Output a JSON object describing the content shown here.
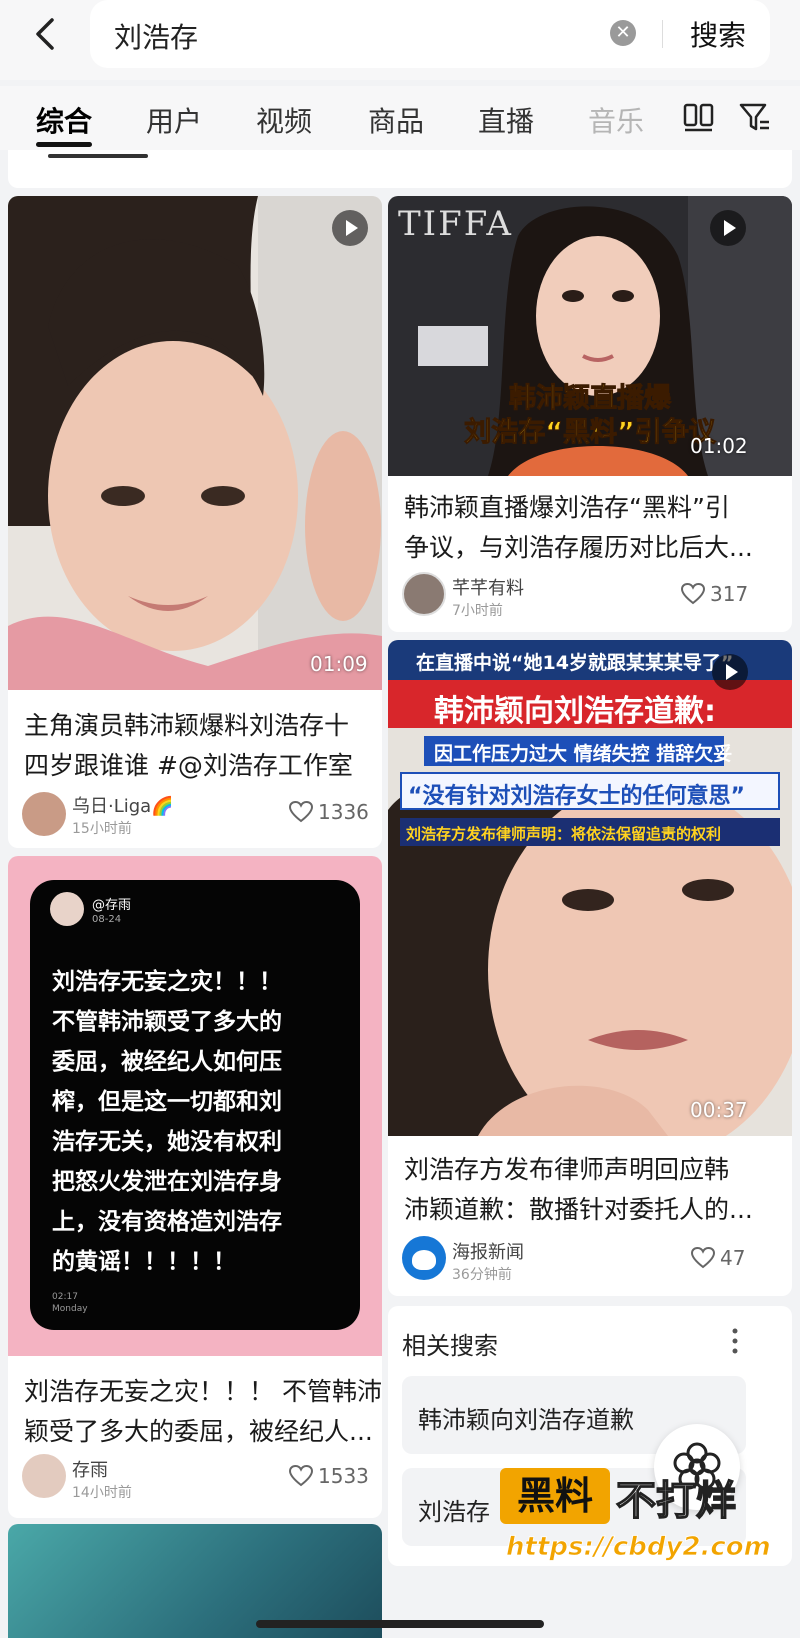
{
  "search": {
    "query": "刘浩存",
    "button_label": "搜索"
  },
  "tabs": [
    {
      "label": "综合"
    },
    {
      "label": "用户"
    },
    {
      "label": "视频"
    },
    {
      "label": "商品"
    },
    {
      "label": "直播"
    },
    {
      "label": "音乐"
    }
  ],
  "feed": {
    "card1": {
      "duration": "01:09",
      "title_line1": "主角演员韩沛颖爆料刘浩存十",
      "title_line2": "四岁跟谁谁 #@刘浩存工作室",
      "author": "乌日·Liga🌈",
      "time": "15小时前",
      "likes": "1336"
    },
    "card2": {
      "thumb_brand": "TIFFA",
      "overlay_line1": "韩沛颖直播爆",
      "overlay_line2": "刘浩存“黑料”引争议",
      "duration": "01:02",
      "title_line1": "韩沛颖直播爆刘浩存“黑料”引",
      "title_line2": "争议，与刘浩存履历对比后大...",
      "author": "芊芊有料",
      "time": "7小时前",
      "likes": "317"
    },
    "card3": {
      "post_user": "@存雨",
      "post_date": "08-24",
      "post_lines": [
        "刘浩存无妄之灾！！！",
        "不管韩沛颖受了多大的",
        "委屈，被经纪人如何压",
        "榨，但是这一切都和刘",
        "浩存无关，她没有权利",
        "把怒火发泄在刘浩存身",
        "上，没有资格造刘浩存",
        "的黄谣！！！！！"
      ],
      "post_time": "02:17",
      "post_day": "Monday",
      "title_line1": "刘浩存无妄之灾！！！ 不管韩沛",
      "title_line2": "颖受了多大的委屈，被经纪人...",
      "author": "存雨",
      "time": "14小时前",
      "likes": "1533"
    },
    "card4": {
      "banner_top": "在直播中说“她14岁就跟某某某导了”",
      "banner_main": "韩沛颖向刘浩存道歉:",
      "banner_sub": "因工作压力过大 情绪失控 措辞欠妥",
      "banner_quote": "“没有针对刘浩存女士的任何意思”",
      "banner_note": "刘浩存方发布律师声明：将依法保留追责的权利",
      "duration": "00:37",
      "title_line1": "刘浩存方发布律师声明回应韩",
      "title_line2": "沛颖道歉：散播针对委托人的...",
      "author": "海报新闻",
      "time": "36分钟前",
      "likes": "47"
    }
  },
  "related": {
    "title": "相关搜索",
    "items": [
      {
        "label": "韩沛颖向刘浩存道歉"
      },
      {
        "label": "刘浩存 1"
      }
    ]
  },
  "watermark": {
    "badge": "黑料",
    "text": "不打烊",
    "url": "https://cbdy2.com"
  },
  "colors": {
    "accent": "#f2a400",
    "banner_red": "#d8262b",
    "banner_blue": "#1d4fb8",
    "card3_bg": "#f4b3c2"
  }
}
